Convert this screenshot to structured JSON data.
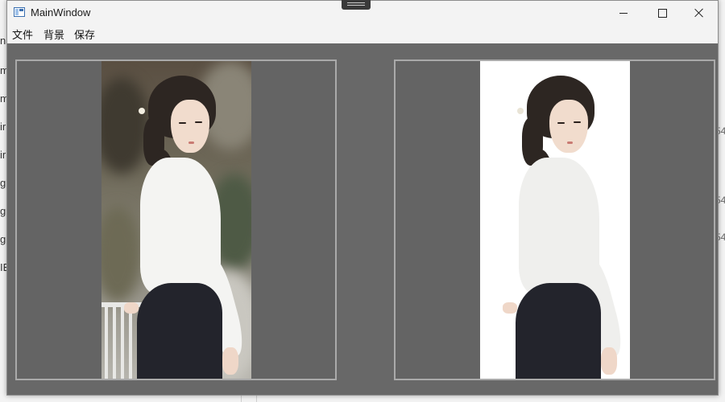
{
  "window": {
    "title": "MainWindow"
  },
  "menu": {
    "file": "文件",
    "background": "背景",
    "save": "保存"
  },
  "panels": {
    "original": {
      "image": "portrait-photo-original-background"
    },
    "result": {
      "image": "portrait-photo-white-background"
    }
  },
  "background_app": {
    "left_fragments": [
      "n",
      "m",
      "m",
      "ir",
      "ir",
      "g.",
      "g.",
      "g.",
      "IB"
    ],
    "right_fragments": [
      "54",
      "54",
      "54"
    ]
  },
  "colors": {
    "window_bg": "#686868",
    "panel_border": "#aaaaaa",
    "titlebar_bg": "#f3f3f3"
  }
}
